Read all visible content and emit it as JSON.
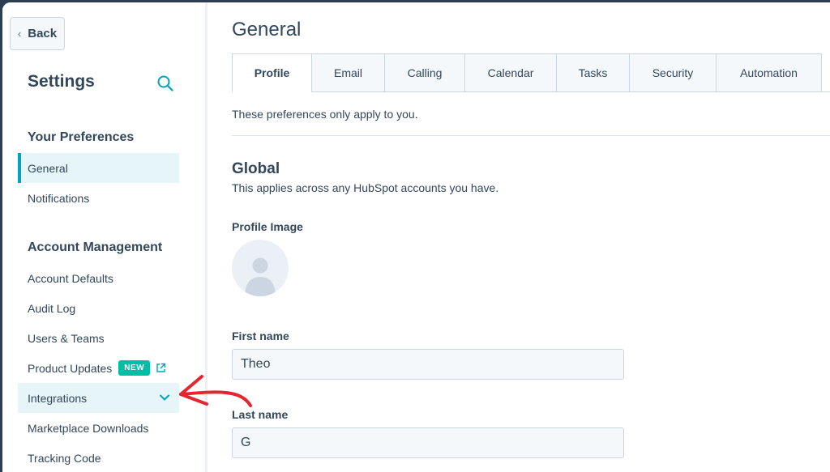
{
  "sidebar": {
    "back_label": "Back",
    "title": "Settings",
    "sections": [
      {
        "heading": "Your Preferences",
        "items": [
          {
            "label": "General",
            "active": true
          },
          {
            "label": "Notifications"
          }
        ]
      },
      {
        "heading": "Account Management",
        "items": [
          {
            "label": "Account Defaults"
          },
          {
            "label": "Audit Log"
          },
          {
            "label": "Users & Teams"
          },
          {
            "label": "Product Updates",
            "badge": "NEW",
            "icon": "external-link-icon"
          },
          {
            "label": "Integrations",
            "icon": "chevron-down-icon"
          },
          {
            "label": "Marketplace Downloads"
          },
          {
            "label": "Tracking Code"
          }
        ]
      }
    ]
  },
  "main": {
    "title": "General",
    "tabs": [
      {
        "label": "Profile",
        "active": true
      },
      {
        "label": "Email"
      },
      {
        "label": "Calling"
      },
      {
        "label": "Calendar"
      },
      {
        "label": "Tasks"
      },
      {
        "label": "Security"
      },
      {
        "label": "Automation"
      }
    ],
    "note": "These preferences only apply to you.",
    "global": {
      "title": "Global",
      "subtitle": "This applies across any HubSpot accounts you have."
    },
    "profile_image_label": "Profile Image",
    "first_name": {
      "label": "First name",
      "value": "Theo"
    },
    "last_name": {
      "label": "Last name",
      "value": "G"
    }
  },
  "colors": {
    "accent": "#00a4bd",
    "badge": "#00bda5",
    "annotation": "#e3262f",
    "text": "#33475b"
  }
}
